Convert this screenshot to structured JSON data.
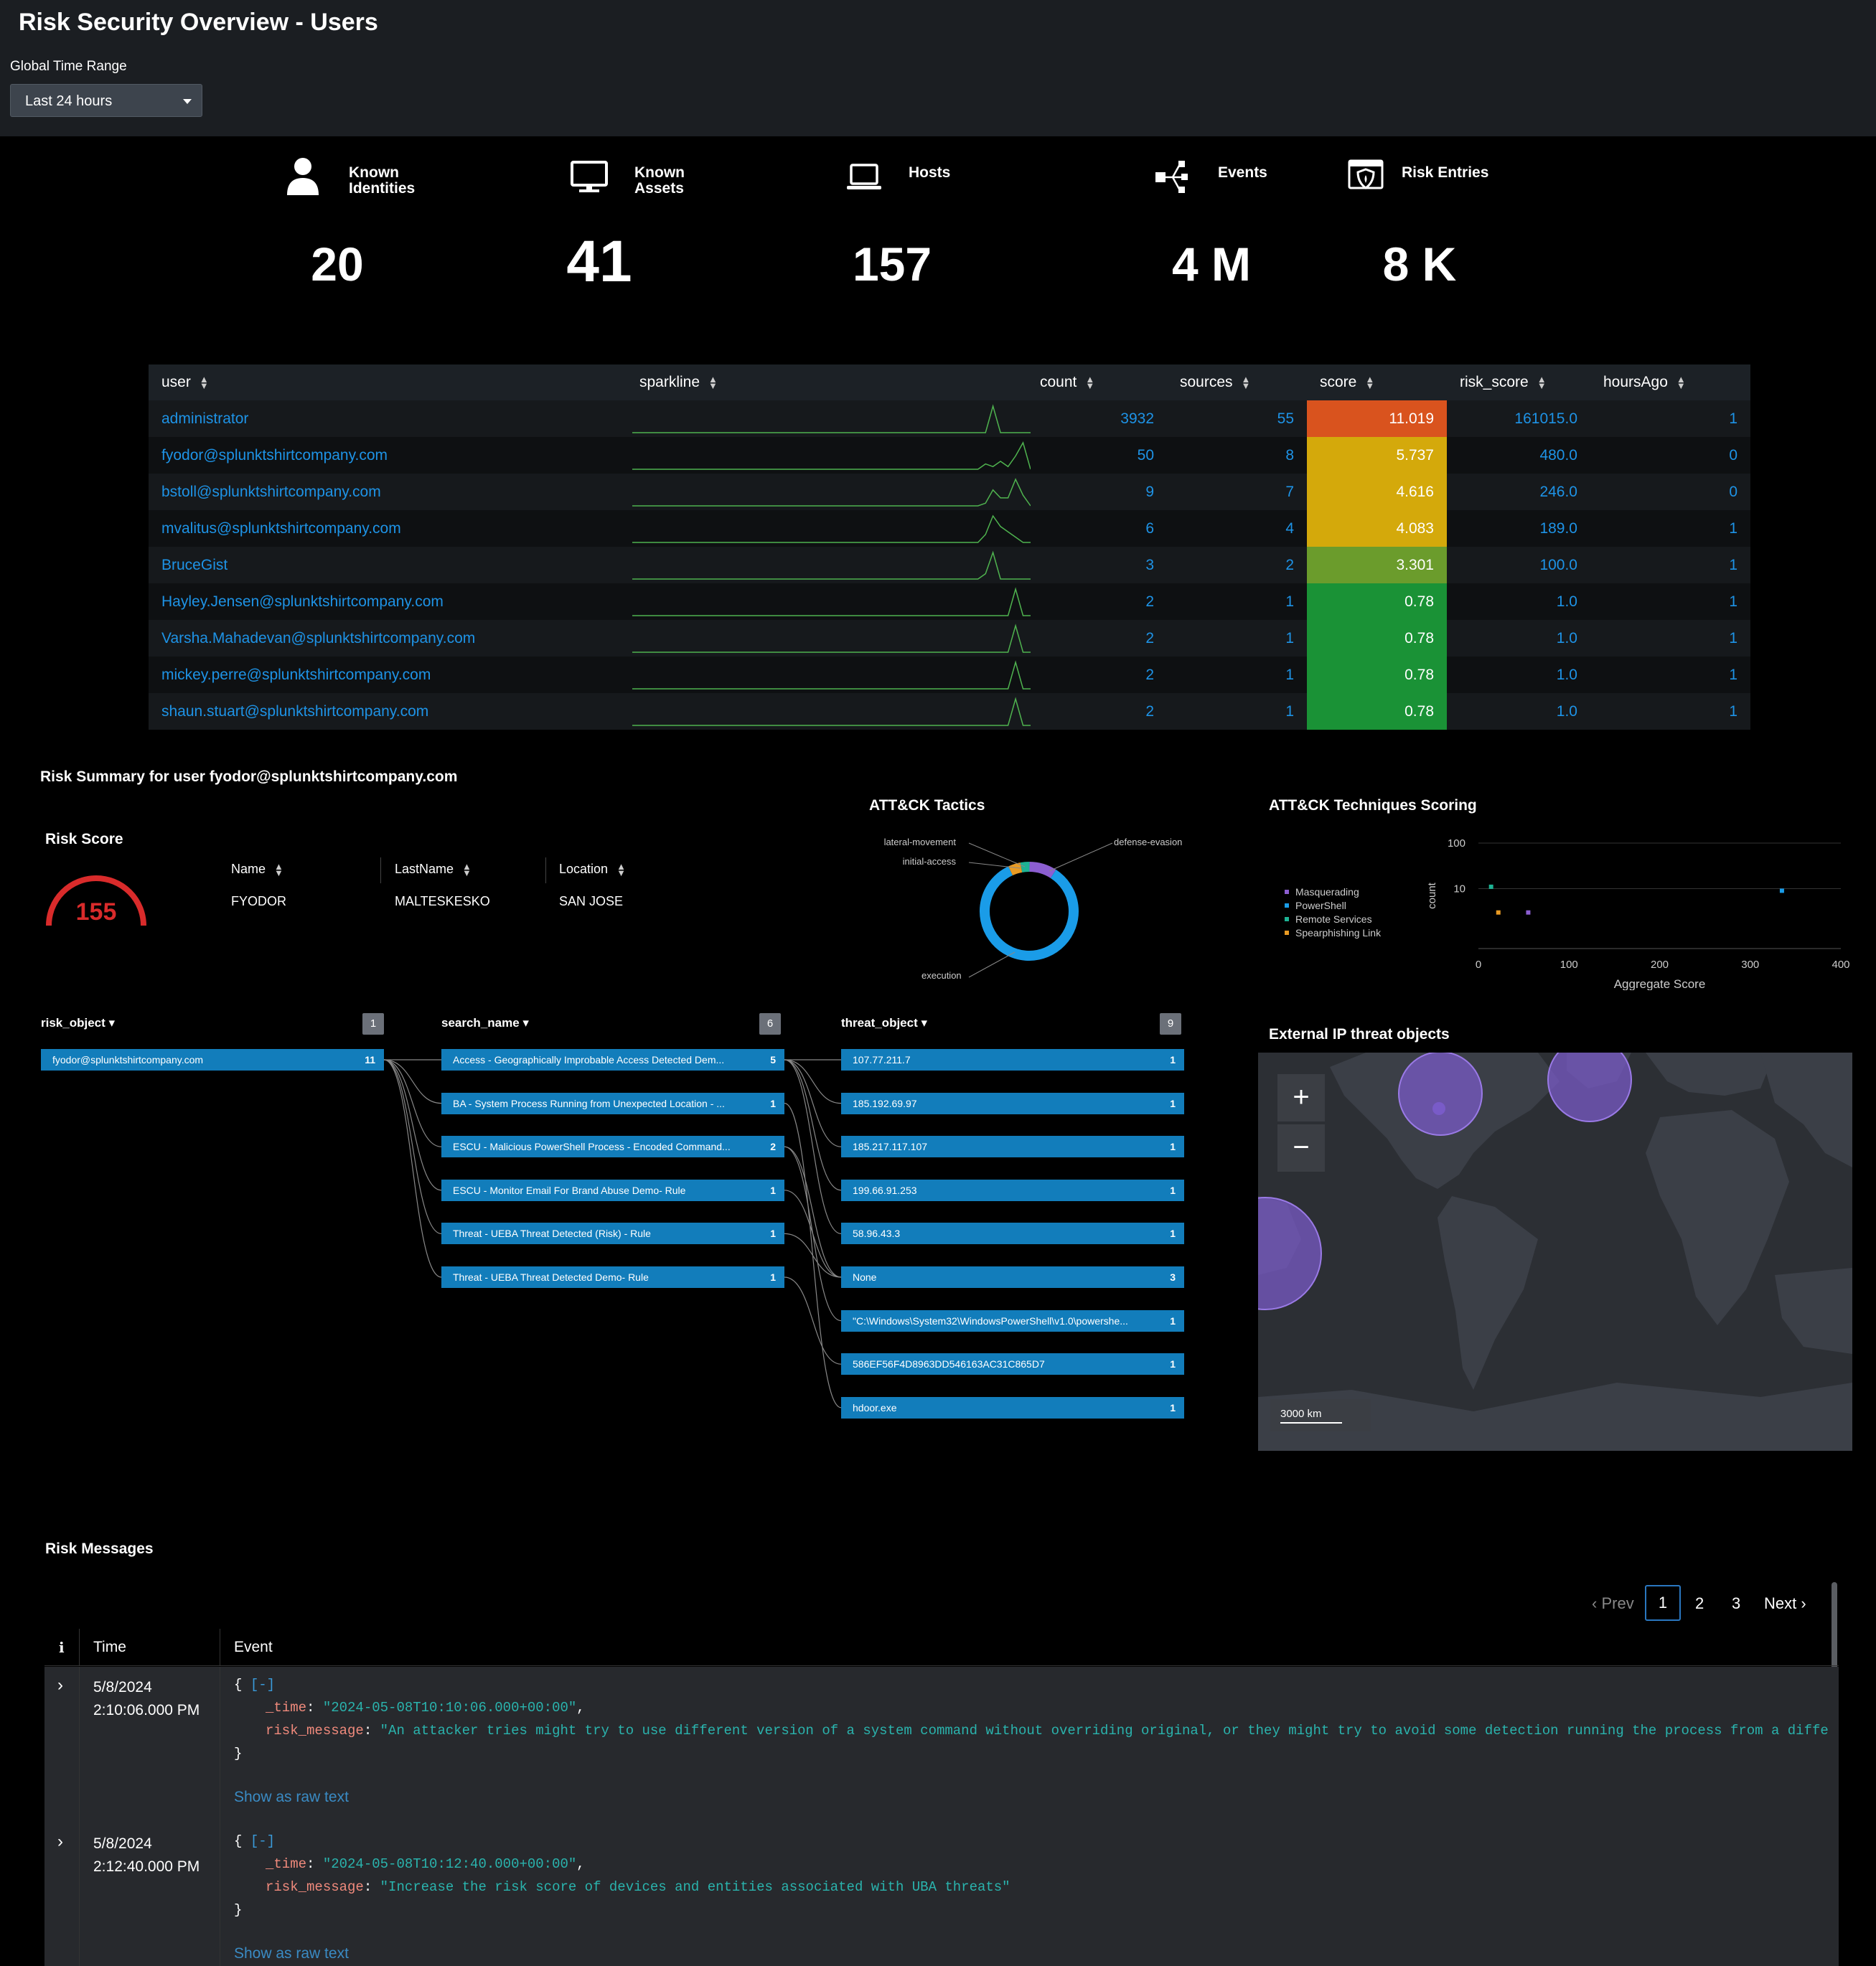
{
  "header": {
    "title": "Risk Security Overview - Users",
    "time_range_label": "Global Time Range",
    "time_range_value": "Last 24 hours"
  },
  "kpis": [
    {
      "label1": "Known",
      "label2": "Identities",
      "value": "20",
      "icon": "user-icon"
    },
    {
      "label1": "Known",
      "label2": "Assets",
      "value": "41",
      "icon": "monitor-icon"
    },
    {
      "label1": "Hosts",
      "label2": "",
      "value": "157",
      "icon": "laptop-icon"
    },
    {
      "label1": "Events",
      "label2": "",
      "value": "4 M",
      "icon": "network-icon"
    },
    {
      "label1": "Risk Entries",
      "label2": "",
      "value": "8 K",
      "icon": "shield-icon"
    }
  ],
  "users_table": {
    "columns": [
      "user",
      "sparkline",
      "count",
      "sources",
      "score",
      "risk_score",
      "hoursAgo"
    ],
    "rows": [
      {
        "user": "administrator",
        "count": "3932",
        "sources": "55",
        "score": "11.019",
        "risk_score": "161015.0",
        "hoursAgo": "1",
        "score_color": "#d9531e",
        "spark": [
          0,
          0,
          0,
          0,
          0,
          0,
          0,
          0,
          0,
          0,
          0,
          0,
          0,
          0,
          0,
          0,
          0,
          0,
          0,
          0,
          0,
          0,
          0,
          0,
          0,
          0,
          0,
          0,
          0,
          0,
          0,
          0,
          0,
          0,
          0,
          0,
          0,
          0,
          0,
          0,
          0,
          0,
          0,
          0,
          0,
          0,
          0,
          0.0,
          1.0,
          0,
          0,
          0,
          0,
          0
        ]
      },
      {
        "user": "fyodor@splunktshirtcompany.com",
        "count": "50",
        "sources": "8",
        "score": "5.737",
        "risk_score": "480.0",
        "hoursAgo": "0",
        "score_color": "#d4a90b",
        "spark": [
          0,
          0,
          0,
          0,
          0,
          0,
          0,
          0,
          0,
          0,
          0,
          0,
          0,
          0,
          0,
          0,
          0,
          0,
          0,
          0,
          0,
          0,
          0,
          0,
          0,
          0,
          0,
          0,
          0,
          0,
          0,
          0,
          0,
          0,
          0,
          0,
          0,
          0,
          0,
          0,
          0,
          0,
          0,
          0,
          0,
          0,
          0,
          0.2,
          0.1,
          0.3,
          0.1,
          0.5,
          1.0,
          0
        ]
      },
      {
        "user": "bstoll@splunktshirtcompany.com",
        "count": "9",
        "sources": "7",
        "score": "4.616",
        "risk_score": "246.0",
        "hoursAgo": "0",
        "score_color": "#d4a90b",
        "spark": [
          0,
          0,
          0,
          0,
          0,
          0,
          0,
          0,
          0,
          0,
          0,
          0,
          0,
          0,
          0,
          0,
          0,
          0,
          0,
          0,
          0,
          0,
          0,
          0,
          0,
          0,
          0,
          0,
          0,
          0,
          0,
          0,
          0,
          0,
          0,
          0,
          0,
          0,
          0,
          0,
          0,
          0,
          0,
          0,
          0,
          0,
          0,
          0.1,
          0.6,
          0.3,
          0.3,
          1.0,
          0.4,
          0
        ]
      },
      {
        "user": "mvalitus@splunktshirtcompany.com",
        "count": "6",
        "sources": "4",
        "score": "4.083",
        "risk_score": "189.0",
        "hoursAgo": "1",
        "score_color": "#d4a90b",
        "spark": [
          0,
          0,
          0,
          0,
          0,
          0,
          0,
          0,
          0,
          0,
          0,
          0,
          0,
          0,
          0,
          0,
          0,
          0,
          0,
          0,
          0,
          0,
          0,
          0,
          0,
          0,
          0,
          0,
          0,
          0,
          0,
          0,
          0,
          0,
          0,
          0,
          0,
          0,
          0,
          0,
          0,
          0,
          0,
          0,
          0,
          0,
          0,
          0.3,
          1.0,
          0.6,
          0.4,
          0.2,
          0,
          0
        ]
      },
      {
        "user": "BruceGist",
        "count": "3",
        "sources": "2",
        "score": "3.301",
        "risk_score": "100.0",
        "hoursAgo": "1",
        "score_color": "#6b9c2c",
        "spark": [
          0,
          0,
          0,
          0,
          0,
          0,
          0,
          0,
          0,
          0,
          0,
          0,
          0,
          0,
          0,
          0,
          0,
          0,
          0,
          0,
          0,
          0,
          0,
          0,
          0,
          0,
          0,
          0,
          0,
          0,
          0,
          0,
          0,
          0,
          0,
          0,
          0,
          0,
          0,
          0,
          0,
          0,
          0,
          0,
          0,
          0,
          0,
          0.2,
          1.0,
          0,
          0,
          0,
          0,
          0
        ]
      },
      {
        "user": "Hayley.Jensen@splunktshirtcompany.com",
        "count": "2",
        "sources": "1",
        "score": "0.78",
        "risk_score": "1.0",
        "hoursAgo": "1",
        "score_color": "#1a9236",
        "spark": [
          0,
          0,
          0,
          0,
          0,
          0,
          0,
          0,
          0,
          0,
          0,
          0,
          0,
          0,
          0,
          0,
          0,
          0,
          0,
          0,
          0,
          0,
          0,
          0,
          0,
          0,
          0,
          0,
          0,
          0,
          0,
          0,
          0,
          0,
          0,
          0,
          0,
          0,
          0,
          0,
          0,
          0,
          0,
          0,
          0,
          0,
          0,
          0,
          0,
          0,
          0,
          1.0,
          0,
          0
        ]
      },
      {
        "user": "Varsha.Mahadevan@splunktshirtcompany.com",
        "count": "2",
        "sources": "1",
        "score": "0.78",
        "risk_score": "1.0",
        "hoursAgo": "1",
        "score_color": "#1a9236",
        "spark": [
          0,
          0,
          0,
          0,
          0,
          0,
          0,
          0,
          0,
          0,
          0,
          0,
          0,
          0,
          0,
          0,
          0,
          0,
          0,
          0,
          0,
          0,
          0,
          0,
          0,
          0,
          0,
          0,
          0,
          0,
          0,
          0,
          0,
          0,
          0,
          0,
          0,
          0,
          0,
          0,
          0,
          0,
          0,
          0,
          0,
          0,
          0,
          0,
          0,
          0,
          0,
          1.0,
          0,
          0
        ]
      },
      {
        "user": "mickey.perre@splunktshirtcompany.com",
        "count": "2",
        "sources": "1",
        "score": "0.78",
        "risk_score": "1.0",
        "hoursAgo": "1",
        "score_color": "#1a9236",
        "spark": [
          0,
          0,
          0,
          0,
          0,
          0,
          0,
          0,
          0,
          0,
          0,
          0,
          0,
          0,
          0,
          0,
          0,
          0,
          0,
          0,
          0,
          0,
          0,
          0,
          0,
          0,
          0,
          0,
          0,
          0,
          0,
          0,
          0,
          0,
          0,
          0,
          0,
          0,
          0,
          0,
          0,
          0,
          0,
          0,
          0,
          0,
          0,
          0,
          0,
          0,
          0,
          1.0,
          0,
          0
        ]
      },
      {
        "user": "shaun.stuart@splunktshirtcompany.com",
        "count": "2",
        "sources": "1",
        "score": "0.78",
        "risk_score": "1.0",
        "hoursAgo": "1",
        "score_color": "#1a9236",
        "spark": [
          0,
          0,
          0,
          0,
          0,
          0,
          0,
          0,
          0,
          0,
          0,
          0,
          0,
          0,
          0,
          0,
          0,
          0,
          0,
          0,
          0,
          0,
          0,
          0,
          0,
          0,
          0,
          0,
          0,
          0,
          0,
          0,
          0,
          0,
          0,
          0,
          0,
          0,
          0,
          0,
          0,
          0,
          0,
          0,
          0,
          0,
          0,
          0,
          0,
          0,
          0,
          1.0,
          0,
          0
        ]
      }
    ]
  },
  "risk_summary": {
    "title": "Risk Summary for user fyodor@splunktshirtcompany.com",
    "risk_score_title": "Risk Score",
    "risk_score_value": "155",
    "details_columns": [
      "Name",
      "LastName",
      "Location"
    ],
    "details_values": [
      "FYODOR",
      "MALTESKESKO",
      "SAN JOSE"
    ]
  },
  "tactics_chart": {
    "title": "ATT&CK Tactics"
  },
  "techniques_chart": {
    "title": "ATT&CK Techniques Scoring"
  },
  "chart_data": [
    {
      "type": "pie",
      "title": "ATT&CK Tactics",
      "labels": [
        "execution",
        "defense-evasion",
        "lateral-movement",
        "initial-access"
      ],
      "values": [
        0.84,
        0.09,
        0.03,
        0.04
      ],
      "colors": [
        "#1a9ce8",
        "#8c5ed1",
        "#1db394",
        "#e89a23"
      ],
      "style": "donut"
    },
    {
      "type": "scatter",
      "title": "ATT&CK Techniques Scoring",
      "xlabel": "Aggregate Score",
      "ylabel": "count",
      "xlim": [
        0,
        400
      ],
      "ylim": [
        1,
        100
      ],
      "yscale": "log",
      "x_ticks": [
        "0",
        "100",
        "200",
        "300",
        "400"
      ],
      "y_ticks": [
        "10",
        "100"
      ],
      "legend_position": "left",
      "series": [
        {
          "name": "Masquerading",
          "color": "#8c5ed1",
          "points": [
            [
              55,
              3
            ]
          ]
        },
        {
          "name": "PowerShell",
          "color": "#1a9ce8",
          "points": [
            [
              335,
              9
            ]
          ]
        },
        {
          "name": "Remote Services",
          "color": "#1db394",
          "points": [
            [
              14,
              11
            ]
          ]
        },
        {
          "name": "Spearphishing Link",
          "color": "#e89a23",
          "points": [
            [
              22,
              3
            ]
          ]
        }
      ]
    }
  ],
  "flow": {
    "col1": {
      "header": "risk_object",
      "count": "1",
      "items": [
        {
          "label": "fyodor@splunktshirtcompany.com",
          "count": "11"
        }
      ]
    },
    "col2": {
      "header": "search_name",
      "count": "6",
      "items": [
        {
          "label": "Access - Geographically Improbable Access Detected Dem...",
          "count": "5"
        },
        {
          "label": "BA - System Process Running from Unexpected Location - ...",
          "count": "1"
        },
        {
          "label": "ESCU - Malicious PowerShell Process - Encoded Command...",
          "count": "2"
        },
        {
          "label": "ESCU - Monitor Email For Brand Abuse Demo- Rule",
          "count": "1"
        },
        {
          "label": "Threat - UEBA Threat Detected (Risk) - Rule",
          "count": "1"
        },
        {
          "label": "Threat - UEBA Threat Detected Demo- Rule",
          "count": "1"
        }
      ]
    },
    "col3": {
      "header": "threat_object",
      "count": "9",
      "items": [
        {
          "label": "107.77.211.7",
          "count": "1"
        },
        {
          "label": "185.192.69.97",
          "count": "1"
        },
        {
          "label": "185.217.117.107",
          "count": "1"
        },
        {
          "label": "199.66.91.253",
          "count": "1"
        },
        {
          "label": "58.96.43.3",
          "count": "1"
        },
        {
          "label": "None",
          "count": "3"
        },
        {
          "label": "\"C:\\Windows\\System32\\WindowsPowerShell\\v1.0\\powershe...",
          "count": "1"
        },
        {
          "label": "586EF56F4D8963DD546163AC31C865D7",
          "count": "1"
        },
        {
          "label": "hdoor.exe",
          "count": "1"
        }
      ]
    }
  },
  "map": {
    "title": "External IP threat objects",
    "zoom_in": "+",
    "zoom_out": "−",
    "scale": "3000 km"
  },
  "messages": {
    "title": "Risk Messages",
    "pagination": {
      "prev": "Prev",
      "pages": [
        "1",
        "2",
        "3"
      ],
      "next": "Next",
      "current": "1"
    },
    "columns": [
      "i",
      "Time",
      "Event"
    ],
    "rows": [
      {
        "date": "5/8/2024",
        "time": "2:10:06.000 PM",
        "collapse": "[-]",
        "time_val": "\"2024-05-08T10:10:06.000+00:00\"",
        "risk_message": "\"An attacker tries might try to use different version of a system command without overriding original, or they might try to avoid some detection running the process from a different f",
        "raw": "Show as raw text"
      },
      {
        "date": "5/8/2024",
        "time": "2:12:40.000 PM",
        "collapse": "[-]",
        "time_val": "\"2024-05-08T10:12:40.000+00:00\"",
        "risk_message": "\"Increase the risk score of devices and entities associated with UBA threats\"",
        "raw": "Show as raw text"
      }
    ],
    "key_time": "_time",
    "key_msg": "risk_message"
  }
}
